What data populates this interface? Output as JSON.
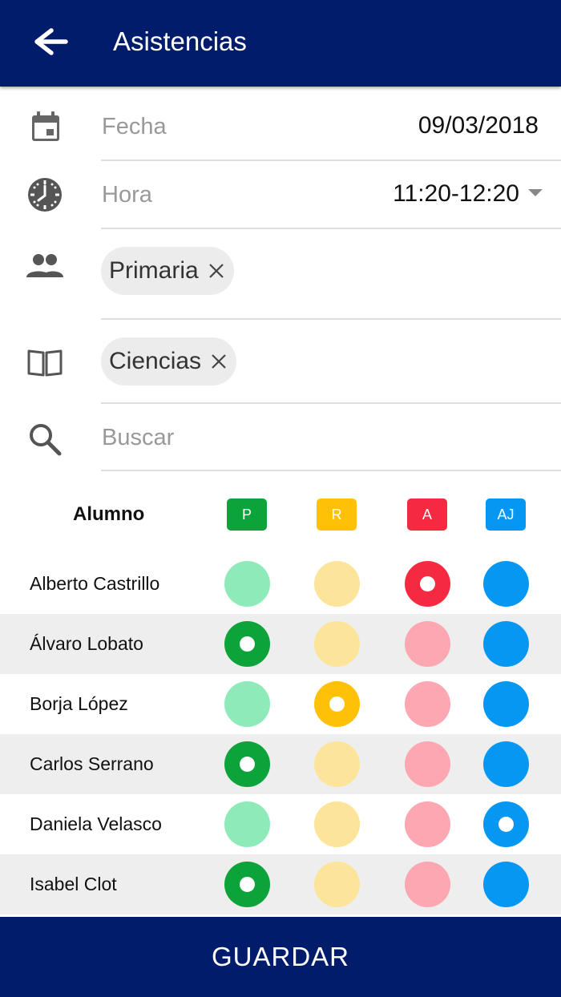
{
  "header": {
    "title": "Asistencias"
  },
  "form": {
    "date": {
      "label": "Fecha",
      "value": "09/03/2018"
    },
    "time": {
      "label": "Hora",
      "value": "11:20-12:20"
    },
    "group_chip": "Primaria",
    "subject_chip": "Ciencias",
    "search": {
      "placeholder": "Buscar"
    }
  },
  "table": {
    "student_header": "Alumno",
    "columns": [
      {
        "label": "P",
        "color": "#0ca33b",
        "light": "#8eeab8"
      },
      {
        "label": "R",
        "color": "#ffc107",
        "light": "#fce59a"
      },
      {
        "label": "A",
        "color": "#f52a40",
        "light": "#fca7b2"
      },
      {
        "label": "AJ",
        "color": "#0597f2",
        "light": "#0597f2"
      }
    ],
    "students": [
      {
        "name": "Alberto Castrillo",
        "status": "A"
      },
      {
        "name": "Álvaro Lobato",
        "status": "P"
      },
      {
        "name": "Borja López",
        "status": "R"
      },
      {
        "name": "Carlos Serrano",
        "status": "P"
      },
      {
        "name": "Daniela Velasco",
        "status": "AJ"
      },
      {
        "name": "Isabel Clot",
        "status": "P"
      }
    ]
  },
  "footer": {
    "save_label": "GUARDAR"
  }
}
